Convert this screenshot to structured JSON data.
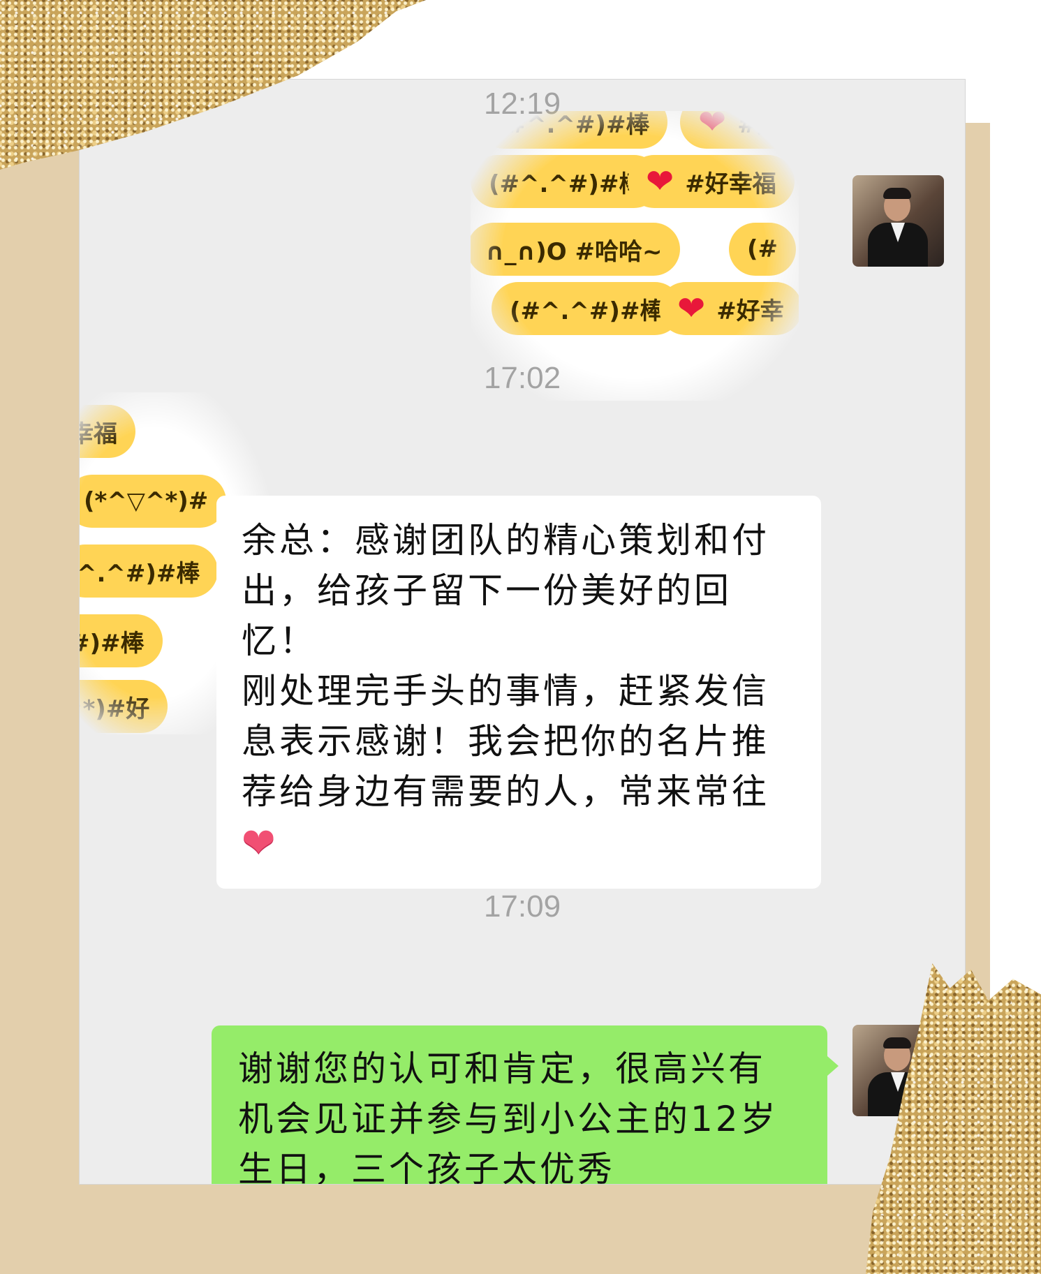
{
  "timestamps": [
    "12:19",
    "17:02",
    "17:09"
  ],
  "sticker_top": {
    "pills": [
      "(#^.^#)#棒",
      "#好",
      "(#^.^#)#棒",
      "#好幸福",
      "∩_∩)O #哈哈~",
      "(#",
      "(#^.^#)#棒",
      "#好幸"
    ],
    "icon": "heart-icon"
  },
  "sticker_left": {
    "pills": [
      "幸福",
      "(*^▽^*)#",
      "^.^#)#棒",
      "#)#棒",
      "^*)#好"
    ]
  },
  "messages": {
    "incoming": {
      "text": "余总：感谢团队的精心策划和付出，给孩子留下一份美好的回忆！\n刚处理完手头的事情，赶紧发信息表示感谢！我会把你的名片推荐给身边有需要的人，常来常往",
      "emoji": "❤"
    },
    "outgoing": {
      "text": "谢谢您的认可和肯定，很高兴有机会见证并参与到小公主的12岁生日，三个孩子太优秀"
    }
  },
  "colors": {
    "chat_background": "#ededed",
    "outgoing_bubble": "#95ec69",
    "incoming_bubble": "#ffffff",
    "backdrop": "#e3cfac",
    "glitter": "#c9a45a",
    "sticker_pill": "#ffd455",
    "heart": "#e8183a"
  }
}
